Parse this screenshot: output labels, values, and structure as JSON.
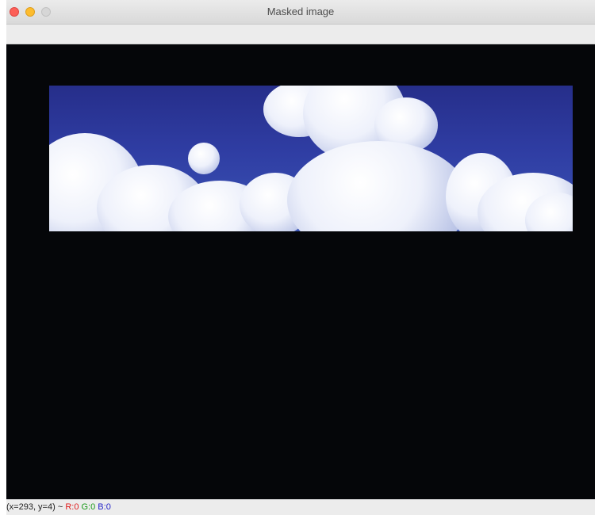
{
  "window": {
    "title": "Masked image"
  },
  "status": {
    "coords": "(x=293, y=4) ~",
    "r": "R:0",
    "g": "G:0",
    "b": "B:0"
  },
  "canvas": {
    "image_content": "clouds-photo"
  },
  "colors": {
    "mask_background": "#050609",
    "sky": "#2f3da3",
    "close": "#fc5f57",
    "minimize": "#fdbc2e",
    "zoom": "#d6d6d6",
    "r_channel": "#e01b1b",
    "g_channel": "#1a9a1a",
    "b_channel": "#2424c8"
  }
}
